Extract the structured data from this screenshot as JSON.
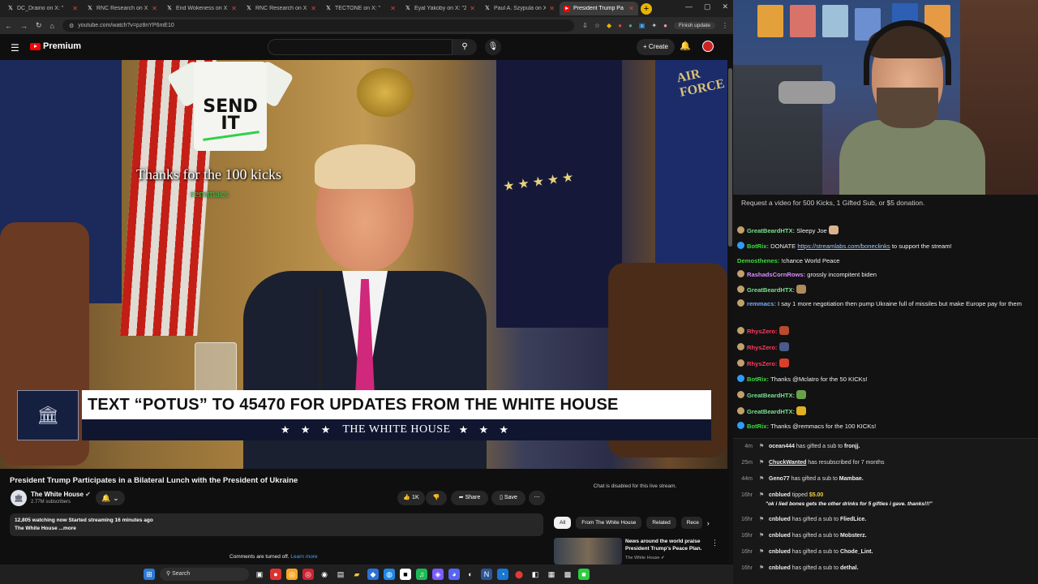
{
  "browser": {
    "tabs": [
      {
        "title": "DC_Draino on X: \"",
        "active": false
      },
      {
        "title": "RNC Research on X:",
        "active": false
      },
      {
        "title": "End Wokeness on X:",
        "active": false
      },
      {
        "title": "RNC Research on X:",
        "active": false
      },
      {
        "title": "TECTONE on X: \"",
        "active": false
      },
      {
        "title": "Eyal Yakoby on X: \"Zo",
        "active": false
      },
      {
        "title": "Paul A. Szypula on X:",
        "active": false
      },
      {
        "title": "President Trump Pa",
        "active": true
      }
    ],
    "url": "youtube.com/watch?v=pz8nYP6mE10",
    "finish_update": "Finish update"
  },
  "youtube": {
    "logo": "Premium",
    "create": "Create",
    "video": {
      "shirt_text": "SEND IT",
      "overlay_kicks": "Thanks for the 100 kicks",
      "overlay_user": "remmacs",
      "lower_third": "TEXT “POTUS” TO 45470 FOR UPDATES FROM THE WHITE HOUSE",
      "lower_brand": "THE WHITE HOUSE",
      "lower_stars": "★ ★ ★"
    },
    "title": "President Trump Participates in a Bilateral Lunch with the President of Ukraine",
    "channel": {
      "name": "The White House",
      "subs": "2.77M subscribers"
    },
    "likes": "1K",
    "share": "Share",
    "save": "Save",
    "desc_line1": "12,805 watching now  Started streaming 16 minutes ago",
    "desc_line2": "The White House ...more",
    "comments_off": "Comments are turned off.",
    "learn_more": "Learn more",
    "chat_disabled": "Chat is disabled for this live stream.",
    "chips": [
      "All",
      "From The White House",
      "Related",
      "Rece"
    ],
    "rec": {
      "title": "News around the world praise President Trump's Peace Plan.",
      "channel": "The White House"
    }
  },
  "stream": {
    "command_banner": "Request a video for 500 Kicks, 1 Gifted Sub, or $5 donation.",
    "chat": [
      {
        "user": "GreatBeardHTX",
        "color": "#78e08f",
        "text": "Sleepy Joe",
        "emote": "#d9b38c",
        "badge": "#c2a06b"
      },
      {
        "user": "BotRix",
        "color": "#3ddc3d",
        "text": "DONATE",
        "link": "https://streamlabs.com/boneclinks",
        "text2": "to support the stream!",
        "badge": "#2f9bff"
      },
      {
        "user": "Demosthenes",
        "color": "#3ddc3d",
        "text": "!chance World Peace",
        "badge": ""
      },
      {
        "user": "RashadsCornRows",
        "color": "#d98cff",
        "text": "grossly incompitent biden",
        "badge": "#c2a06b"
      },
      {
        "user": "GreatBeardHTX",
        "color": "#78e08f",
        "text": "",
        "emote": "#b08a5a",
        "badge": "#c2a06b"
      },
      {
        "user": "remmacs",
        "color": "#7aa8ff",
        "text": "I say 1 more negotiation then pump Ukraine full of missiles but make Europe pay for them",
        "badge": "#c2a06b"
      },
      {
        "user": "RhysZero",
        "color": "#ff3b5c",
        "text": "",
        "emote": "#b84a2f",
        "badge": "#c2a06b"
      },
      {
        "user": "RhysZero",
        "color": "#ff3b5c",
        "text": "",
        "emote": "#4a5a8a",
        "badge": "#c2a06b"
      },
      {
        "user": "RhysZero",
        "color": "#ff3b5c",
        "text": "",
        "emote": "#d8402a",
        "badge": "#c2a06b"
      },
      {
        "user": "BotRix",
        "color": "#3ddc3d",
        "text": "Thanks @Mclatro for the 50 KICKs!",
        "badge": "#2f9bff"
      },
      {
        "user": "GreatBeardHTX",
        "color": "#78e08f",
        "text": "",
        "emote": "#6aa04a",
        "badge": "#c2a06b"
      },
      {
        "user": "GreatBeardHTX",
        "color": "#78e08f",
        "text": "",
        "emote": "#e0b020",
        "badge": "#c2a06b"
      },
      {
        "user": "BotRix",
        "color": "#3ddc3d",
        "text": "Thanks @remmacs for the 100 KICKs!",
        "badge": "#2f9bff"
      }
    ],
    "events": [
      {
        "time": "4m",
        "user": "ocean444",
        "text": "has gifted a sub to",
        "target": "fronjj."
      },
      {
        "time": "25m",
        "user": "ChuckWanted",
        "text": "has resubscribed for 7 months",
        "target": ""
      },
      {
        "time": "44m",
        "user": "Geno77",
        "text": "has gifted a sub to",
        "target": "Mambae."
      },
      {
        "time": "16hr",
        "user": "cnblued",
        "text": "tipped",
        "target": "$5.00"
      },
      {
        "time": "16hr",
        "user": "cnblued",
        "text": "has gifted a sub to",
        "target": "FliedLice."
      },
      {
        "time": "16hr",
        "user": "cnblued",
        "text": "has gifted a sub to",
        "target": "Mobsterz."
      },
      {
        "time": "16hr",
        "user": "cnblued",
        "text": "has gifted a sub to",
        "target": "Chode_Lint."
      },
      {
        "time": "16hr",
        "user": "cnblued",
        "text": "has gifted a sub to",
        "target": "dethal."
      }
    ],
    "tip_message": "\"ok i lied bones gets the other drinks for 5 gifties i gave. thanks!!!\""
  },
  "taskbar": {
    "search": "Search"
  }
}
